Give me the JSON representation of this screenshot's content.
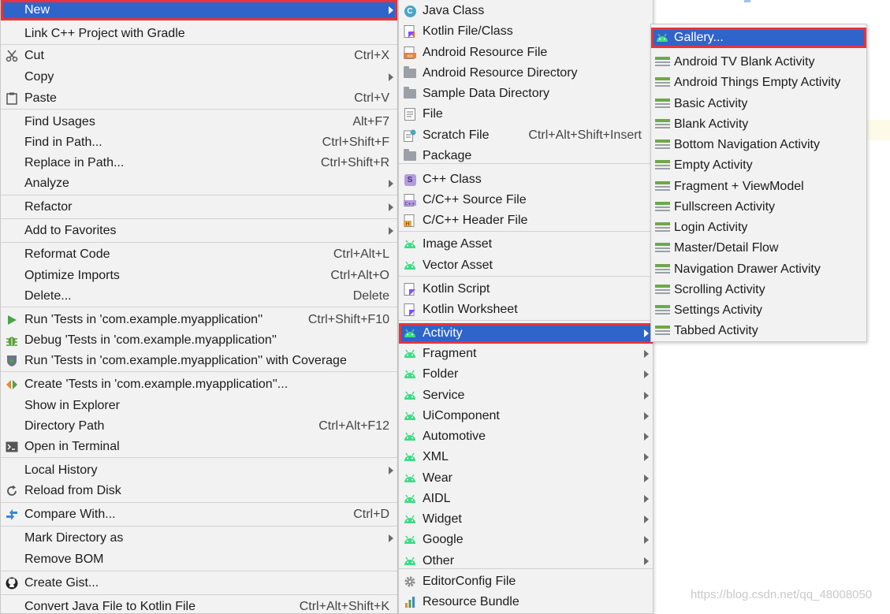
{
  "main_menu": {
    "items": [
      {
        "label": "New",
        "shortcut": "",
        "arrow": true,
        "icon": "",
        "selected": true,
        "highlighted": true
      },
      {
        "label": "Link C++ Project with Gradle",
        "shortcut": "",
        "arrow": false,
        "icon": ""
      },
      {
        "label": "Cut",
        "shortcut": "Ctrl+X",
        "arrow": false,
        "icon": "scissors-icon"
      },
      {
        "label": "Copy",
        "shortcut": "",
        "arrow": true,
        "icon": ""
      },
      {
        "label": "Paste",
        "shortcut": "Ctrl+V",
        "arrow": false,
        "icon": "clipboard-icon"
      },
      {
        "label": "Find Usages",
        "shortcut": "Alt+F7",
        "arrow": false,
        "icon": ""
      },
      {
        "label": "Find in Path...",
        "shortcut": "Ctrl+Shift+F",
        "arrow": false,
        "icon": ""
      },
      {
        "label": "Replace in Path...",
        "shortcut": "Ctrl+Shift+R",
        "arrow": false,
        "icon": ""
      },
      {
        "label": "Analyze",
        "shortcut": "",
        "arrow": true,
        "icon": ""
      },
      {
        "label": "Refactor",
        "shortcut": "",
        "arrow": true,
        "icon": ""
      },
      {
        "label": "Add to Favorites",
        "shortcut": "",
        "arrow": true,
        "icon": ""
      },
      {
        "label": "Reformat Code",
        "shortcut": "Ctrl+Alt+L",
        "arrow": false,
        "icon": ""
      },
      {
        "label": "Optimize Imports",
        "shortcut": "Ctrl+Alt+O",
        "arrow": false,
        "icon": ""
      },
      {
        "label": "Delete...",
        "shortcut": "Delete",
        "arrow": false,
        "icon": ""
      },
      {
        "label": "Run 'Tests in 'com.example.myapplication''",
        "shortcut": "Ctrl+Shift+F10",
        "arrow": false,
        "icon": "run-icon"
      },
      {
        "label": "Debug 'Tests in 'com.example.myapplication''",
        "shortcut": "",
        "arrow": false,
        "icon": "debug-icon"
      },
      {
        "label": "Run 'Tests in 'com.example.myapplication'' with Coverage",
        "shortcut": "",
        "arrow": false,
        "icon": "coverage-icon"
      },
      {
        "label": "Create 'Tests in 'com.example.myapplication''...",
        "shortcut": "",
        "arrow": false,
        "icon": "create-config-icon"
      },
      {
        "label": "Show in Explorer",
        "shortcut": "",
        "arrow": false,
        "icon": ""
      },
      {
        "label": "Directory Path",
        "shortcut": "Ctrl+Alt+F12",
        "arrow": false,
        "icon": ""
      },
      {
        "label": "Open in Terminal",
        "shortcut": "",
        "arrow": false,
        "icon": "terminal-icon"
      },
      {
        "label": "Local History",
        "shortcut": "",
        "arrow": true,
        "icon": ""
      },
      {
        "label": "Reload from Disk",
        "shortcut": "",
        "arrow": false,
        "icon": "reload-icon"
      },
      {
        "label": "Compare With...",
        "shortcut": "Ctrl+D",
        "arrow": false,
        "icon": "compare-icon"
      },
      {
        "label": "Mark Directory as",
        "shortcut": "",
        "arrow": true,
        "icon": ""
      },
      {
        "label": "Remove BOM",
        "shortcut": "",
        "arrow": false,
        "icon": ""
      },
      {
        "label": "Create Gist...",
        "shortcut": "",
        "arrow": false,
        "icon": "github-icon"
      },
      {
        "label": "Convert Java File to Kotlin File",
        "shortcut": "Ctrl+Alt+Shift+K",
        "arrow": false,
        "icon": ""
      }
    ]
  },
  "new_submenu": {
    "items": [
      {
        "label": "Java Class",
        "shortcut": "",
        "arrow": false,
        "icon": "java-class-icon"
      },
      {
        "label": "Kotlin File/Class",
        "shortcut": "",
        "arrow": false,
        "icon": "kotlin-file-icon"
      },
      {
        "label": "Android Resource File",
        "shortcut": "",
        "arrow": false,
        "icon": "android-resource-file-icon"
      },
      {
        "label": "Android Resource Directory",
        "shortcut": "",
        "arrow": false,
        "icon": "folder-icon"
      },
      {
        "label": "Sample Data Directory",
        "shortcut": "",
        "arrow": false,
        "icon": "folder-icon"
      },
      {
        "label": "File",
        "shortcut": "",
        "arrow": false,
        "icon": "file-icon"
      },
      {
        "label": "Scratch File",
        "shortcut": "Ctrl+Alt+Shift+Insert",
        "arrow": false,
        "icon": "scratch-file-icon"
      },
      {
        "label": "Package",
        "shortcut": "",
        "arrow": false,
        "icon": "package-icon"
      },
      {
        "label": "C++ Class",
        "shortcut": "",
        "arrow": false,
        "icon": "cpp-class-icon"
      },
      {
        "label": "C/C++ Source File",
        "shortcut": "",
        "arrow": false,
        "icon": "cpp-source-icon"
      },
      {
        "label": "C/C++ Header File",
        "shortcut": "",
        "arrow": false,
        "icon": "cpp-header-icon"
      },
      {
        "label": "Image Asset",
        "shortcut": "",
        "arrow": false,
        "icon": "android-icon"
      },
      {
        "label": "Vector Asset",
        "shortcut": "",
        "arrow": false,
        "icon": "android-icon"
      },
      {
        "label": "Kotlin Script",
        "shortcut": "",
        "arrow": false,
        "icon": "kotlin-script-icon"
      },
      {
        "label": "Kotlin Worksheet",
        "shortcut": "",
        "arrow": false,
        "icon": "kotlin-worksheet-icon"
      },
      {
        "label": "Activity",
        "shortcut": "",
        "arrow": true,
        "icon": "android-icon",
        "selected": true,
        "highlighted": true
      },
      {
        "label": "Fragment",
        "shortcut": "",
        "arrow": true,
        "icon": "android-icon"
      },
      {
        "label": "Folder",
        "shortcut": "",
        "arrow": true,
        "icon": "android-icon"
      },
      {
        "label": "Service",
        "shortcut": "",
        "arrow": true,
        "icon": "android-icon"
      },
      {
        "label": "UiComponent",
        "shortcut": "",
        "arrow": true,
        "icon": "android-icon"
      },
      {
        "label": "Automotive",
        "shortcut": "",
        "arrow": true,
        "icon": "android-icon"
      },
      {
        "label": "XML",
        "shortcut": "",
        "arrow": true,
        "icon": "android-icon"
      },
      {
        "label": "Wear",
        "shortcut": "",
        "arrow": true,
        "icon": "android-icon"
      },
      {
        "label": "AIDL",
        "shortcut": "",
        "arrow": true,
        "icon": "android-icon"
      },
      {
        "label": "Widget",
        "shortcut": "",
        "arrow": true,
        "icon": "android-icon"
      },
      {
        "label": "Google",
        "shortcut": "",
        "arrow": true,
        "icon": "android-icon"
      },
      {
        "label": "Other",
        "shortcut": "",
        "arrow": true,
        "icon": "android-icon"
      },
      {
        "label": "EditorConfig File",
        "shortcut": "",
        "arrow": false,
        "icon": "gear-icon"
      },
      {
        "label": "Resource Bundle",
        "shortcut": "",
        "arrow": false,
        "icon": "resource-bundle-icon"
      }
    ]
  },
  "activity_submenu": {
    "items": [
      {
        "label": "Gallery...",
        "icon": "android-icon",
        "selected": true,
        "highlighted": true
      },
      {
        "label": "Android TV Blank Activity",
        "icon": "activity-template-icon"
      },
      {
        "label": "Android Things Empty Activity",
        "icon": "activity-template-icon"
      },
      {
        "label": "Basic Activity",
        "icon": "activity-template-icon"
      },
      {
        "label": "Blank Activity",
        "icon": "activity-template-icon"
      },
      {
        "label": "Bottom Navigation Activity",
        "icon": "activity-template-icon"
      },
      {
        "label": "Empty Activity",
        "icon": "activity-template-icon"
      },
      {
        "label": "Fragment + ViewModel",
        "icon": "activity-template-icon"
      },
      {
        "label": "Fullscreen Activity",
        "icon": "activity-template-icon"
      },
      {
        "label": "Login Activity",
        "icon": "activity-template-icon"
      },
      {
        "label": "Master/Detail Flow",
        "icon": "activity-template-icon"
      },
      {
        "label": "Navigation Drawer Activity",
        "icon": "activity-template-icon"
      },
      {
        "label": "Scrolling Activity",
        "icon": "activity-template-icon"
      },
      {
        "label": "Settings Activity",
        "icon": "activity-template-icon"
      },
      {
        "label": "Tabbed Activity",
        "icon": "activity-template-icon"
      }
    ]
  },
  "watermark": "https://blog.csdn.net/qq_48008050",
  "colors": {
    "selection": "#2f65ca",
    "highlight_box": "#e8323c",
    "android_green": "#3ddc84",
    "menu_bg": "#f2f2f2"
  }
}
